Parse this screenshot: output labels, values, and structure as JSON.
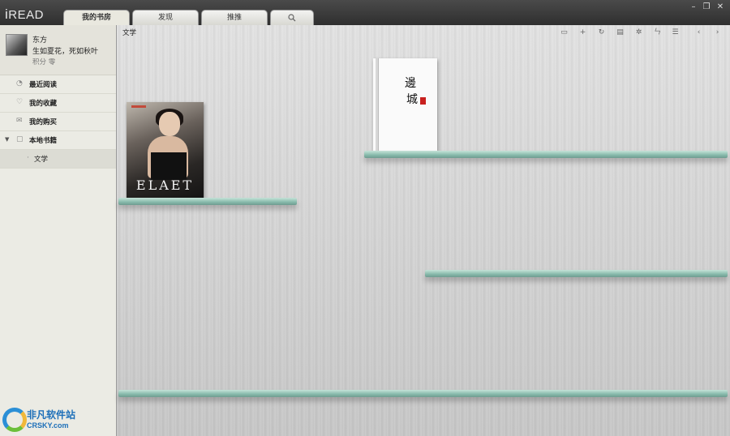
{
  "app": {
    "logo_i": "i",
    "logo_rest": "READ"
  },
  "tabs": [
    {
      "label": "我的书房",
      "active": true
    },
    {
      "label": "发现"
    },
    {
      "label": "推推"
    },
    {
      "label": "",
      "icon": "search-icon"
    }
  ],
  "window_controls": {
    "minimize": "–",
    "restore": "❐",
    "close": "✕"
  },
  "profile": {
    "name": "东方",
    "motto": "生如夏花，死如秋叶",
    "points": "积分 零"
  },
  "nav": {
    "recent": "最近阅读",
    "favorites": "我的收藏",
    "purchased": "我的购买",
    "local": "本地书籍",
    "local_arrow": "▼",
    "literature": "文学"
  },
  "breadcrumb": "文学",
  "toolbar_icons": [
    "window-icon",
    "add-icon",
    "refresh-icon",
    "list-view-icon",
    "settings-icon",
    "sort-icon",
    "menu-icon",
    "prev-icon",
    "next-icon"
  ],
  "books": [
    {
      "cover_title": "ELAET"
    },
    {
      "cover_title_line1": "邊",
      "cover_title_line2": "城"
    }
  ],
  "watermark": {
    "cn": "非凡软件站",
    "en": "CRSKY.com"
  },
  "colors": {
    "titlebar": "#3b3b3b",
    "sidebar": "#ebebe4",
    "shelf": "#86b9aa",
    "seal": "#c8201e"
  }
}
